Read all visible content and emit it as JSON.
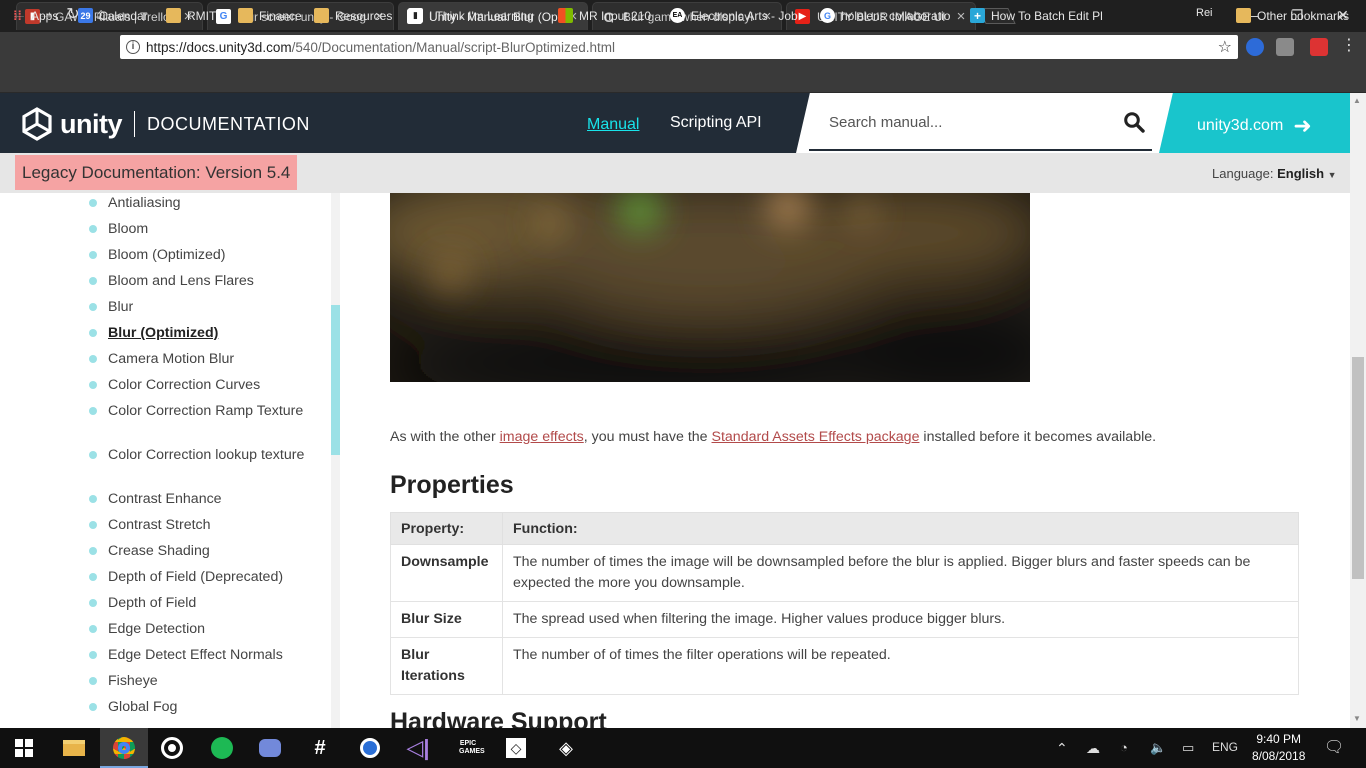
{
  "browser": {
    "tabs": [
      {
        "title": "* GAW - Rituals | Trello",
        "icon": "trello-icon",
        "active": false
      },
      {
        "title": "blur screen unity - Google",
        "icon": "google-icon",
        "active": false
      },
      {
        "title": "Unity - Manual: Blur (Opt",
        "icon": "unity-icon",
        "active": true
      },
      {
        "title": "Blur game when displayin",
        "icon": "loading-icon",
        "active": false
      },
      {
        "title": "UNITY BLUR IMAGE UI",
        "icon": "youtube-icon",
        "active": false
      }
    ],
    "profile": "Rei",
    "url_host": "https://docs.unity3d.com",
    "url_path": "/540/Documentation/Manual/script-BlurOptimized.html",
    "bookmarks": [
      {
        "label": "Apps",
        "icon": "apps-grid-icon"
      },
      {
        "label": "Calendar",
        "icon": "calendar-icon",
        "badge": "29"
      },
      {
        "label": "RMIT",
        "icon": "folder-icon"
      },
      {
        "label": "Finance",
        "icon": "folder-icon"
      },
      {
        "label": "Resources",
        "icon": "folder-icon"
      },
      {
        "label": "I Think I'm Learning",
        "icon": "page-icon"
      },
      {
        "label": "MR Input 210",
        "icon": "microsoft-icon"
      },
      {
        "label": "Electronic Arts - Job",
        "icon": "ea-icon"
      },
      {
        "label": "hololens collaboratio",
        "icon": "google-icon"
      },
      {
        "label": "How To Batch Edit Pl",
        "icon": "plus-icon"
      }
    ],
    "other_bookmarks": "Other bookmarks"
  },
  "header": {
    "logo_text": "unity",
    "section": "DOCUMENTATION",
    "nav_manual": "Manual",
    "nav_scripting": "Scripting API",
    "search_placeholder": "Search manual...",
    "site_link": "unity3d.com"
  },
  "legacy": {
    "label": "Legacy Documentation: Version 5.4",
    "language_prefix": "Language:",
    "language": "English"
  },
  "sidebar": {
    "items": [
      {
        "label": "Antialiasing"
      },
      {
        "label": "Bloom"
      },
      {
        "label": "Bloom (Optimized)"
      },
      {
        "label": "Bloom and Lens Flares"
      },
      {
        "label": "Blur"
      },
      {
        "label": "Blur (Optimized)",
        "current": true
      },
      {
        "label": "Camera Motion Blur"
      },
      {
        "label": "Color Correction Curves"
      },
      {
        "label": "Color Correction Ramp Texture"
      },
      {
        "label": "Color Correction lookup texture"
      },
      {
        "label": "Contrast Enhance"
      },
      {
        "label": "Contrast Stretch"
      },
      {
        "label": "Crease Shading"
      },
      {
        "label": "Depth of Field (Deprecated)"
      },
      {
        "label": "Depth of Field"
      },
      {
        "label": "Edge Detection"
      },
      {
        "label": "Edge Detect Effect Normals"
      },
      {
        "label": "Fisheye"
      },
      {
        "label": "Global Fog"
      }
    ]
  },
  "content": {
    "intro_before": "As with the other ",
    "intro_link1": "image effects",
    "intro_middle": ", you must have the ",
    "intro_link2": "Standard Assets Effects package",
    "intro_after": " installed before it becomes available.",
    "properties_heading": "Properties",
    "table_headers": [
      "Property:",
      "Function:"
    ],
    "properties": [
      {
        "name": "Downsample",
        "function": "The number of times the image will be downsampled before the blur is applied. Bigger blurs and faster speeds can be expected the more you downsample."
      },
      {
        "name": "Blur Size",
        "function": "The spread used when filtering the image. Higher values produce bigger blurs."
      },
      {
        "name": "Blur Iterations",
        "function": "The number of of times the filter operations will be repeated."
      }
    ],
    "hardware_heading": "Hardware Support"
  },
  "taskbar": {
    "language": "ENG",
    "time": "9:40 PM",
    "date": "8/08/2018",
    "epic_label": "EPIC GAMES"
  },
  "colors": {
    "unity_header": "#222c37",
    "accent_cyan": "#19c5cc",
    "legacy_badge": "#f5a3a3",
    "link_red": "#b24a4a",
    "bullet": "#9be1e6"
  }
}
